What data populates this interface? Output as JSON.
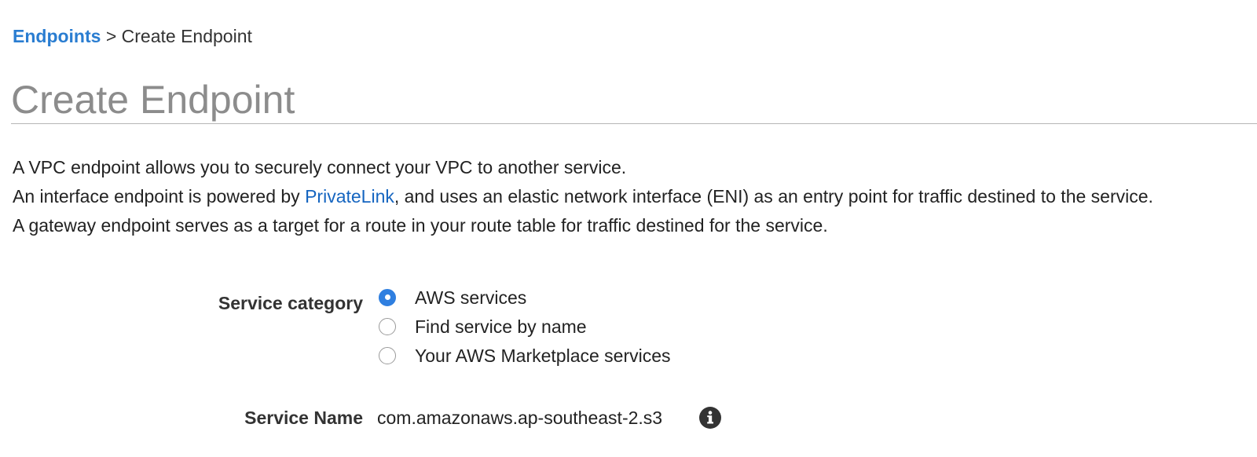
{
  "breadcrumb": {
    "link_label": "Endpoints",
    "separator": ">",
    "current": "Create Endpoint"
  },
  "page_title": "Create Endpoint",
  "description": {
    "line1": "A VPC endpoint allows you to securely connect your VPC to another service.",
    "line2_before": "An interface endpoint is powered by ",
    "line2_link": "PrivateLink",
    "line2_after": ", and uses an elastic network interface (ENI) as an entry point for traffic destined to the service.",
    "line3": "A gateway endpoint serves as a target for a route in your route table for traffic destined for the service."
  },
  "service_category": {
    "label": "Service category",
    "options": [
      {
        "label": "AWS services",
        "selected": true
      },
      {
        "label": "Find service by name",
        "selected": false
      },
      {
        "label": "Your AWS Marketplace services",
        "selected": false
      }
    ]
  },
  "service_name": {
    "label": "Service Name",
    "value": "com.amazonaws.ap-southeast-2.s3",
    "icon": "info-icon"
  },
  "colors": {
    "link": "#2a7dd1",
    "radio_selected": "#2f7fe0",
    "title": "#8c8c8c"
  }
}
